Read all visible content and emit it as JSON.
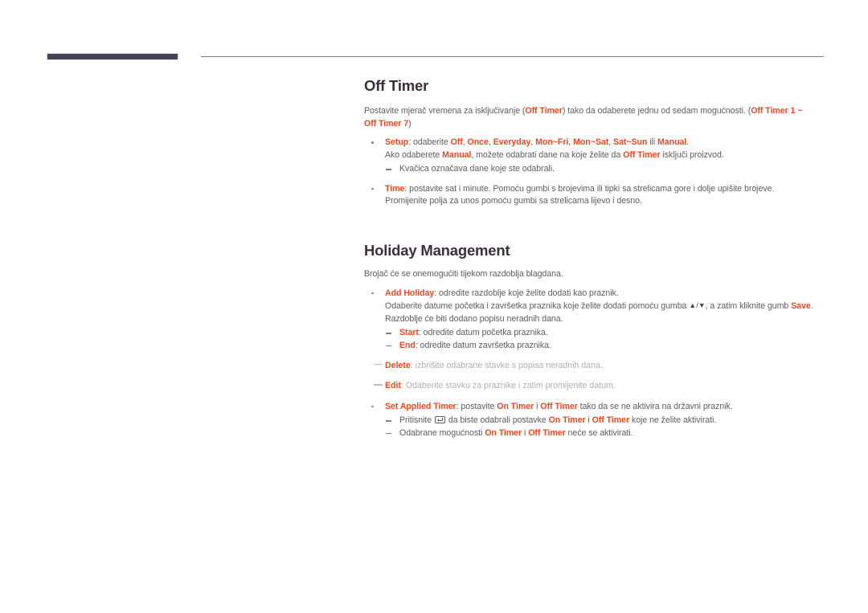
{
  "document": {
    "type": "user-manual-page",
    "language": "hr"
  },
  "colors": {
    "accent": "#e8491f",
    "heading": "#3b2f3c",
    "body": "#5d5d61",
    "faded": "#b2b0b2",
    "marker_bar": "#474257",
    "rule": "#7c7c80"
  },
  "sections": [
    {
      "id": "off-timer",
      "title": "Off Timer",
      "intro": {
        "parts": [
          {
            "t": "Postavite mjerač vremena za isključivanje (",
            "kw": false
          },
          {
            "t": "Off Timer",
            "kw": true
          },
          {
            "t": ") tako da odaberete jednu od sedam mogućnosti. (",
            "kw": false
          },
          {
            "t": "Off Timer 1 ~ Off Timer 7",
            "kw": true
          },
          {
            "t": ")",
            "kw": false
          }
        ]
      },
      "bullets": [
        {
          "lines": [
            {
              "parts": [
                {
                  "t": "Setup",
                  "kw": true
                },
                {
                  "t": ": odaberite ",
                  "kw": false
                },
                {
                  "t": "Off",
                  "kw": true
                },
                {
                  "t": ", ",
                  "kw": false
                },
                {
                  "t": "Once",
                  "kw": true
                },
                {
                  "t": ", ",
                  "kw": false
                },
                {
                  "t": "Everyday",
                  "kw": true
                },
                {
                  "t": ", ",
                  "kw": false
                },
                {
                  "t": "Mon~Fri",
                  "kw": true
                },
                {
                  "t": ", ",
                  "kw": false
                },
                {
                  "t": "Mon~Sat",
                  "kw": true
                },
                {
                  "t": ", ",
                  "kw": false
                },
                {
                  "t": "Sat~Sun",
                  "kw": true
                },
                {
                  "t": " ili ",
                  "kw": false
                },
                {
                  "t": "Manual",
                  "kw": true
                },
                {
                  "t": ".",
                  "kw": false
                }
              ]
            },
            {
              "parts": [
                {
                  "t": "Ako odaberete ",
                  "kw": false
                },
                {
                  "t": "Manual",
                  "kw": true
                },
                {
                  "t": ", možete odabrati dane na koje želite da ",
                  "kw": false
                },
                {
                  "t": "Off Timer",
                  "kw": true
                },
                {
                  "t": " isključi proizvod.",
                  "kw": false
                }
              ]
            }
          ],
          "subs": [
            {
              "parts": [
                {
                  "t": "Kvačica označava dane koje ste odabrali.",
                  "kw": false
                }
              ]
            }
          ]
        },
        {
          "lines": [
            {
              "parts": [
                {
                  "t": "Time",
                  "kw": true
                },
                {
                  "t": ": postavite sat i minute. Pomoću gumbi s brojevima ili tipki sa strelicama gore i dolje upišite brojeve. Promijenite polja za unos pomoću gumbi sa strelicama lijevo i desno.",
                  "kw": false
                }
              ]
            }
          ],
          "subs": []
        }
      ]
    },
    {
      "id": "holiday-management",
      "title": "Holiday Management",
      "intro_plain": "Brojač će se onemogućiti tijekom razdoblja blagdana.",
      "bullets": [
        {
          "lines": [
            {
              "parts": [
                {
                  "t": "Add Holiday",
                  "kw": true
                },
                {
                  "t": ": odredite razdoblje koje želite dodati kao praznik.",
                  "kw": false
                }
              ]
            },
            {
              "parts": [
                {
                  "t": "Odaberite datume početka i završetka praznika koje želite dodati pomoću gumba ",
                  "kw": false
                },
                {
                  "t": "▲/▼",
                  "glyph": "arrows-up-down"
                },
                {
                  "t": ", a zatim kliknite gumb ",
                  "kw": false
                },
                {
                  "t": "Save",
                  "kw": true
                },
                {
                  "t": ".",
                  "kw": false
                }
              ]
            },
            {
              "parts": [
                {
                  "t": "Razdoblje će biti dodano popisu neradnih dana.",
                  "kw": false
                }
              ]
            }
          ],
          "subs": [
            {
              "parts": [
                {
                  "t": "Start",
                  "kw": true
                },
                {
                  "t": ": odredite datum početka praznika.",
                  "kw": false
                }
              ]
            },
            {
              "parts": [
                {
                  "t": "End",
                  "kw": true
                },
                {
                  "t": ": odredite datum završetka praznika.",
                  "kw": false
                }
              ]
            }
          ]
        }
      ],
      "faded_rows": [
        {
          "parts": [
            {
              "t": "Delete",
              "kw": true
            },
            {
              "t": ": izbrišite odabrane stavke s popisa neradnih dana.",
              "kw": false
            }
          ]
        },
        {
          "parts": [
            {
              "t": "Edit",
              "kw": true
            },
            {
              "t": ": Odaberite stavku za praznike i zatim promijenite datum.",
              "kw": false
            }
          ]
        }
      ],
      "bullets_after": [
        {
          "lines": [
            {
              "parts": [
                {
                  "t": "Set Applied Timer",
                  "kw": true
                },
                {
                  "t": ": postavite ",
                  "kw": false
                },
                {
                  "t": "On Timer",
                  "kw": true
                },
                {
                  "t": " i ",
                  "kw": false
                },
                {
                  "t": "Off Timer",
                  "kw": true
                },
                {
                  "t": " tako da se ne aktivira na državni praznik.",
                  "kw": false
                }
              ]
            }
          ],
          "subs": [
            {
              "parts": [
                {
                  "t": "Pritisnite ",
                  "kw": false
                },
                {
                  "t": "",
                  "glyph": "enter-key"
                },
                {
                  "t": " da biste odabrali postavke ",
                  "kw": false
                },
                {
                  "t": "On Timer",
                  "kw": true
                },
                {
                  "t": " i ",
                  "kw": false
                },
                {
                  "t": "Off Timer",
                  "kw": true
                },
                {
                  "t": " koje ne želite aktivirati.",
                  "kw": false
                }
              ]
            },
            {
              "parts": [
                {
                  "t": "Odabrane mogućnosti ",
                  "kw": false
                },
                {
                  "t": "On Timer",
                  "kw": true
                },
                {
                  "t": " i ",
                  "kw": false
                },
                {
                  "t": "Off Timer",
                  "kw": true
                },
                {
                  "t": " neće se aktivirati.",
                  "kw": false
                }
              ]
            }
          ]
        }
      ]
    }
  ]
}
